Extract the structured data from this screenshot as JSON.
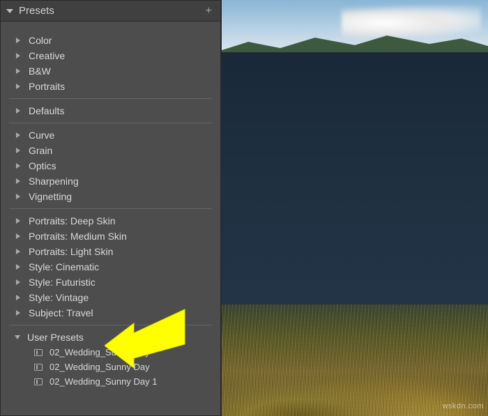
{
  "panel": {
    "title": "Presets",
    "add_tooltip": "+",
    "groups": [
      {
        "items": [
          {
            "label": "Color",
            "expanded": false
          },
          {
            "label": "Creative",
            "expanded": false
          },
          {
            "label": "B&W",
            "expanded": false
          },
          {
            "label": "Portraits",
            "expanded": false
          }
        ]
      },
      {
        "items": [
          {
            "label": "Defaults",
            "expanded": false
          }
        ]
      },
      {
        "items": [
          {
            "label": "Curve",
            "expanded": false
          },
          {
            "label": "Grain",
            "expanded": false
          },
          {
            "label": "Optics",
            "expanded": false
          },
          {
            "label": "Sharpening",
            "expanded": false
          },
          {
            "label": "Vignetting",
            "expanded": false
          }
        ]
      },
      {
        "items": [
          {
            "label": "Portraits: Deep Skin",
            "expanded": false
          },
          {
            "label": "Portraits: Medium Skin",
            "expanded": false
          },
          {
            "label": "Portraits: Light Skin",
            "expanded": false
          },
          {
            "label": "Style: Cinematic",
            "expanded": false
          },
          {
            "label": "Style: Futuristic",
            "expanded": false
          },
          {
            "label": "Style: Vintage",
            "expanded": false
          },
          {
            "label": "Subject: Travel",
            "expanded": false
          }
        ]
      },
      {
        "items": [
          {
            "label": "User Presets",
            "expanded": true,
            "presets": [
              {
                "label": "02_Wedding_Sunny Day"
              },
              {
                "label": "02_Wedding_Sunny Day"
              },
              {
                "label": "02_Wedding_Sunny Day 1"
              }
            ]
          }
        ]
      }
    ]
  },
  "watermark": "wskdn.com"
}
